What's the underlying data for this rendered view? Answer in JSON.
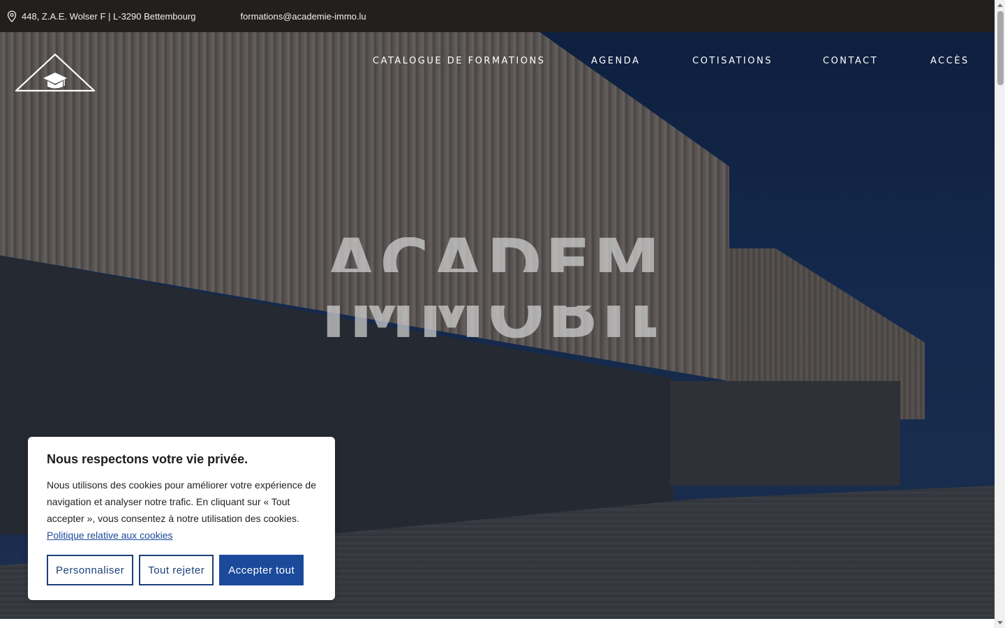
{
  "topbar": {
    "address": "448, Z.A.E. Wolser F | L-3290 Bettembourg",
    "email": "formations@academie-immo.lu",
    "location_icon": "map-pin-icon"
  },
  "header": {
    "logo_icon": "graduation-cap-house-logo",
    "nav": [
      {
        "label": "CATALOGUE DE FORMATIONS"
      },
      {
        "label": "AGENDA"
      },
      {
        "label": "COTISATIONS"
      },
      {
        "label": "CONTACT"
      },
      {
        "label": "ACCÈS"
      }
    ]
  },
  "hero": {
    "title_line1": "ACADEMIE",
    "title_line2": "IMMOBILI"
  },
  "cookie_banner": {
    "title": "Nous respectons votre vie privée.",
    "body": "Nous utilisons des cookies pour améliorer votre expérience de navigation et analyser notre trafic. En cliquant sur « Tout accepter », vous consentez à notre utilisation des cookies.",
    "policy_link": "Politique relative aux cookies",
    "buttons": {
      "customize": "Personnaliser",
      "reject": "Tout rejeter",
      "accept": "Accepter tout"
    },
    "accent_color": "#1b4a9b"
  }
}
